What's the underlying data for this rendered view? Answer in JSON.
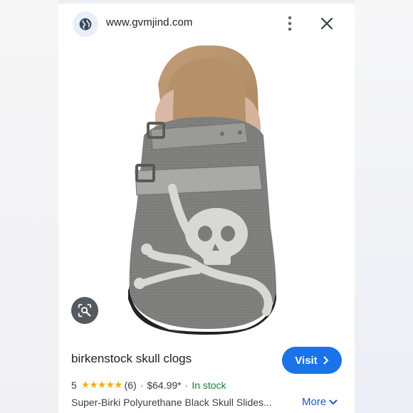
{
  "header": {
    "url": "www.gvmjind.com",
    "globe_icon": "globe-icon",
    "menu_icon": "more-vert-icon",
    "close_icon": "close-icon"
  },
  "image": {
    "lens_icon": "lens-search-icon"
  },
  "product": {
    "title": "birkenstock skull clogs",
    "visit_label": "Visit",
    "rating": "5",
    "stars": "★★★★★",
    "reviews": "(6)",
    "separator": "·",
    "price": "$64.99*",
    "stock": "In stock",
    "description": "Super-Birki Polyurethane Black Skull Slides...",
    "more_label": "More"
  },
  "colors": {
    "accent": "#1a73e8",
    "stock": "#188038",
    "stars": "#f2b01e"
  }
}
